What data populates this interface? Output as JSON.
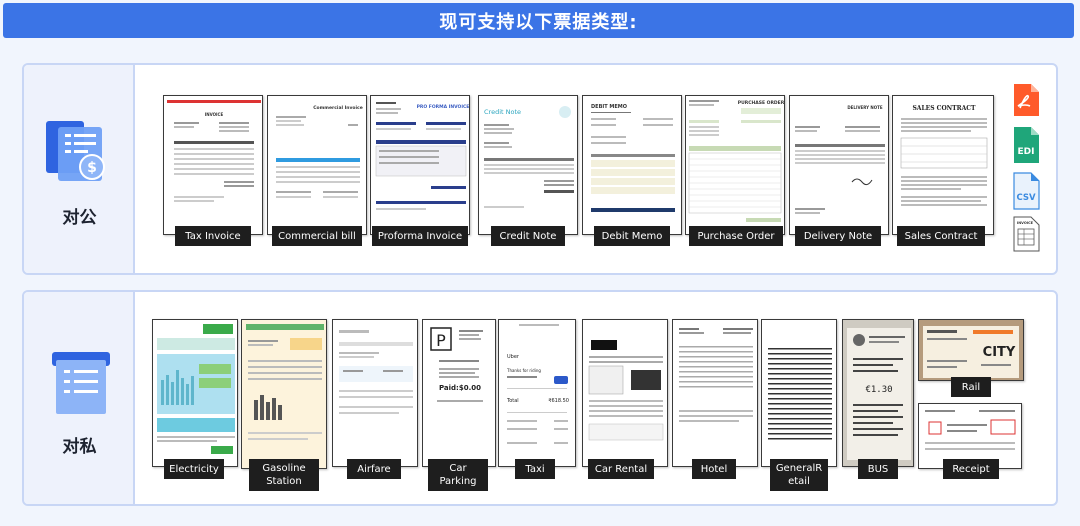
{
  "header": {
    "title": "现可支持以下票据类型:"
  },
  "corporate": {
    "label": "对公",
    "documents": [
      {
        "name": "Tax Invoice"
      },
      {
        "name": "Commercial bill"
      },
      {
        "name": "Proforma Invoice"
      },
      {
        "name": "Credit Note"
      },
      {
        "name": "Debit Memo"
      },
      {
        "name": "Purchase Order"
      },
      {
        "name": "Delivery Note"
      },
      {
        "name": "Sales Contract"
      }
    ],
    "formats": [
      {
        "name": "PDF",
        "icon": "pdf-icon",
        "color": "#ff5a2a"
      },
      {
        "name": "EDI",
        "icon": "edi-icon",
        "color": "#1fa67a"
      },
      {
        "name": "CSV",
        "icon": "csv-icon",
        "color": "#3b8be0"
      },
      {
        "name": "INVOICE",
        "icon": "invoice-icon",
        "color": "#555555"
      }
    ]
  },
  "private": {
    "label": "对私",
    "documents": [
      {
        "name": "Electricity"
      },
      {
        "name": "Gasoline\nStation"
      },
      {
        "name": "Airfare"
      },
      {
        "name": "Car\nParking"
      },
      {
        "name": "Taxi"
      },
      {
        "name": "Car Rental"
      },
      {
        "name": "Hotel"
      },
      {
        "name": "GeneralR\netail"
      },
      {
        "name": "BUS"
      },
      {
        "name": "Rail"
      },
      {
        "name": "Receipt"
      }
    ]
  },
  "thumb_text": {
    "invoice_title": "INVOICE",
    "commercial_title": "Commercial Invoice",
    "proforma_title": "PRO FORMA INVOICE",
    "credit_title": "Credit Note",
    "debit_title": "DEBIT MEMO",
    "po_title": "PURCHASE ORDER",
    "delivery_title": "DELIVERY NOTE",
    "sales_title": "SALES CONTRACT",
    "parking_symbol": "P",
    "parking_paid": "Paid:$0.00",
    "taxi_thanks": "Thanks for riding",
    "taxi_total": "₹618.50",
    "taxi_brand": "Uber",
    "bus_price": "€1.30",
    "rail_city": "CITY"
  },
  "colors": {
    "banner": "#3b74e6",
    "panel_border": "#c8d6f5",
    "label_bg": "#1e1e1e",
    "page_bg": "#f1f5fd"
  }
}
